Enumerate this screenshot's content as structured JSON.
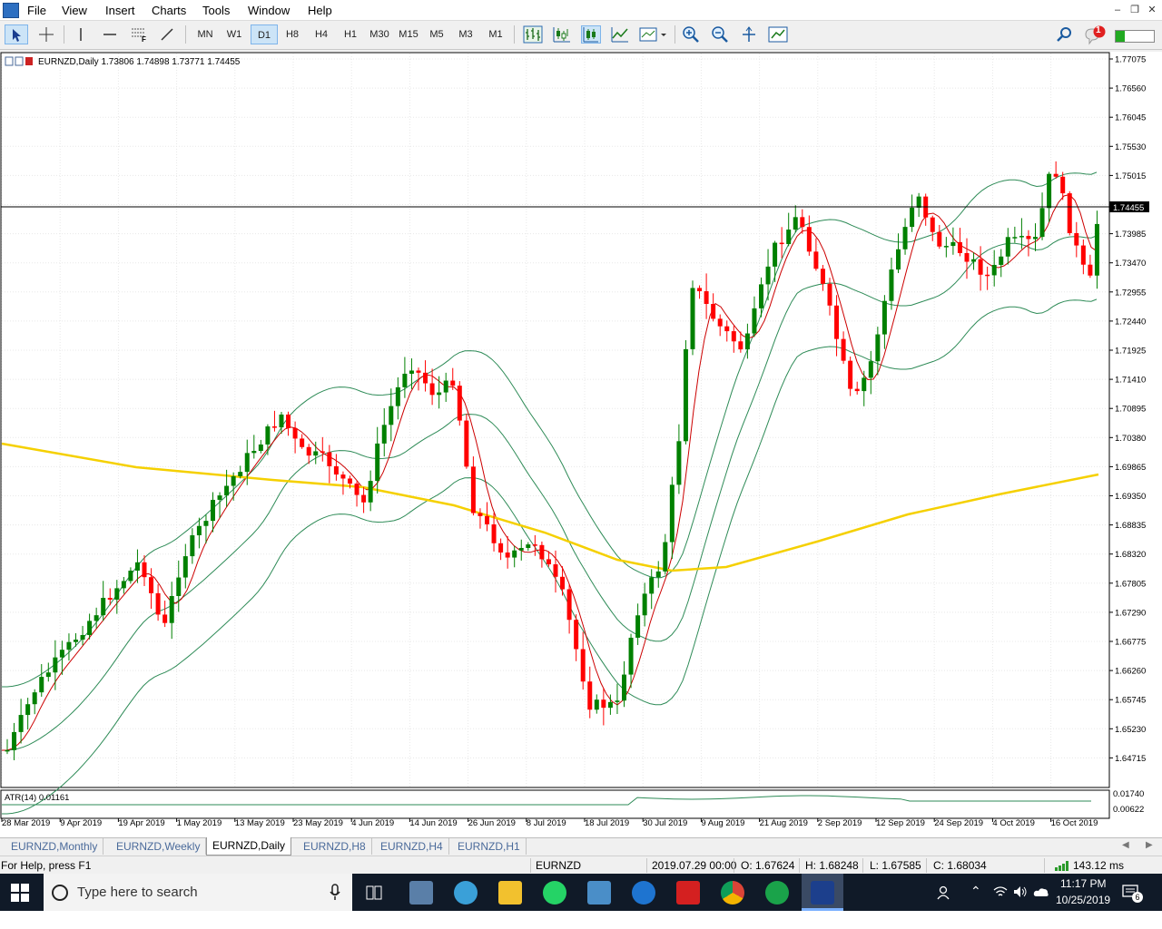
{
  "menu": {
    "items": [
      "File",
      "View",
      "Insert",
      "Charts",
      "Tools",
      "Window",
      "Help"
    ]
  },
  "toolbar": {
    "timeframes": [
      "MN",
      "W1",
      "D1",
      "H8",
      "H4",
      "H1",
      "M30",
      "M15",
      "M5",
      "M3",
      "M1"
    ],
    "active_timeframe": "D1",
    "notification_count": "1"
  },
  "chart": {
    "header": "EURNZD,Daily  1.73806 1.74898 1.73771 1.74455",
    "current_price": "1.74455",
    "price_ticks": [
      "1.77075",
      "1.76560",
      "1.76045",
      "1.75530",
      "1.75015",
      "1.74455",
      "1.73985",
      "1.73470",
      "1.72955",
      "1.72440",
      "1.71925",
      "1.71410",
      "1.70895",
      "1.70380",
      "1.69865",
      "1.69350",
      "1.68835",
      "1.68320",
      "1.67805",
      "1.67290",
      "1.66775",
      "1.66260",
      "1.65745",
      "1.65230",
      "1.64715"
    ],
    "date_ticks": [
      "28 Mar 2019",
      "9 Apr 2019",
      "19 Apr 2019",
      "1 May 2019",
      "13 May 2019",
      "23 May 2019",
      "4 Jun 2019",
      "14 Jun 2019",
      "26 Jun 2019",
      "8 Jul 2019",
      "18 Jul 2019",
      "30 Jul 2019",
      "9 Aug 2019",
      "21 Aug 2019",
      "2 Sep 2019",
      "12 Sep 2019",
      "24 Sep 2019",
      "4 Oct 2019",
      "16 Oct 2019"
    ],
    "indicator_label": "ATR(14) 0.01161",
    "indicator_ticks": [
      "0.01740",
      "0.00622"
    ],
    "colors": {
      "bull": "#008000",
      "bear": "#ff0000",
      "band": "#2e8b57",
      "ma_fast": "#cc0000",
      "ma_slow": "#f5d000"
    }
  },
  "tabs": [
    "EURNZD,Monthly",
    "EURNZD,Weekly",
    "EURNZD,Daily",
    "EURNZD,H8",
    "EURNZD,H4",
    "EURNZD,H1"
  ],
  "active_tab": "EURNZD,Daily",
  "status": {
    "help": "For Help, press F1",
    "symbol": "EURNZD",
    "time": "2019.07.29 00:00",
    "open": "O: 1.67624",
    "high": "H: 1.68248",
    "low": "L: 1.67585",
    "close": "C: 1.68034",
    "ping": "143.12 ms"
  },
  "taskbar": {
    "search_placeholder": "Type here to search",
    "clock_time": "11:17 PM",
    "clock_date": "10/25/2019",
    "notification_count": "6"
  }
}
